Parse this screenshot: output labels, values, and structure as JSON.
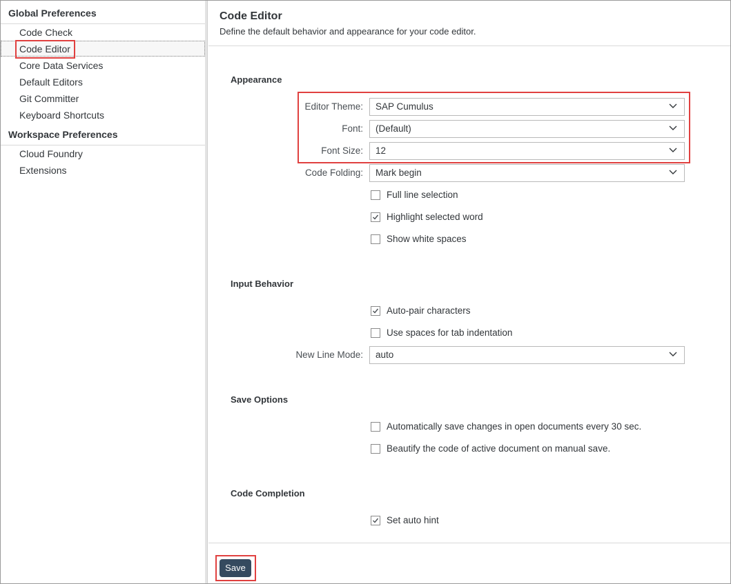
{
  "sidebar": {
    "global_title": "Global Preferences",
    "global_items": [
      "Code Check",
      "Code Editor",
      "Core Data Services",
      "Default Editors",
      "Git Committer",
      "Keyboard Shortcuts"
    ],
    "workspace_title": "Workspace Preferences",
    "workspace_items": [
      "Cloud Foundry",
      "Extensions"
    ],
    "selected": "Code Editor"
  },
  "main": {
    "title": "Code Editor",
    "subtitle": "Define the default behavior and appearance for your code editor.",
    "appearance": {
      "heading": "Appearance",
      "editor_theme_label": "Editor Theme:",
      "editor_theme_value": "SAP Cumulus",
      "font_label": "Font:",
      "font_value": "(Default)",
      "font_size_label": "Font Size:",
      "font_size_value": "12",
      "code_folding_label": "Code Folding:",
      "code_folding_value": "Mark begin",
      "full_line_selection": "Full line selection",
      "full_line_selection_checked": false,
      "highlight_selected_word": "Highlight selected word",
      "highlight_selected_word_checked": true,
      "show_white_spaces": "Show white spaces",
      "show_white_spaces_checked": false
    },
    "input_behavior": {
      "heading": "Input Behavior",
      "auto_pair": "Auto-pair characters",
      "auto_pair_checked": true,
      "use_spaces": "Use spaces for tab indentation",
      "use_spaces_checked": false,
      "new_line_mode_label": "New Line Mode:",
      "new_line_mode_value": "auto"
    },
    "save_options": {
      "heading": "Save Options",
      "auto_save": "Automatically save changes in open documents every 30 sec.",
      "auto_save_checked": false,
      "beautify": "Beautify the code of active document on manual save.",
      "beautify_checked": false
    },
    "code_completion": {
      "heading": "Code Completion",
      "auto_hint": "Set auto hint",
      "auto_hint_checked": true
    },
    "save_label": "Save"
  },
  "colors": {
    "highlight": "#e0403f",
    "save_button": "#354a5f"
  }
}
